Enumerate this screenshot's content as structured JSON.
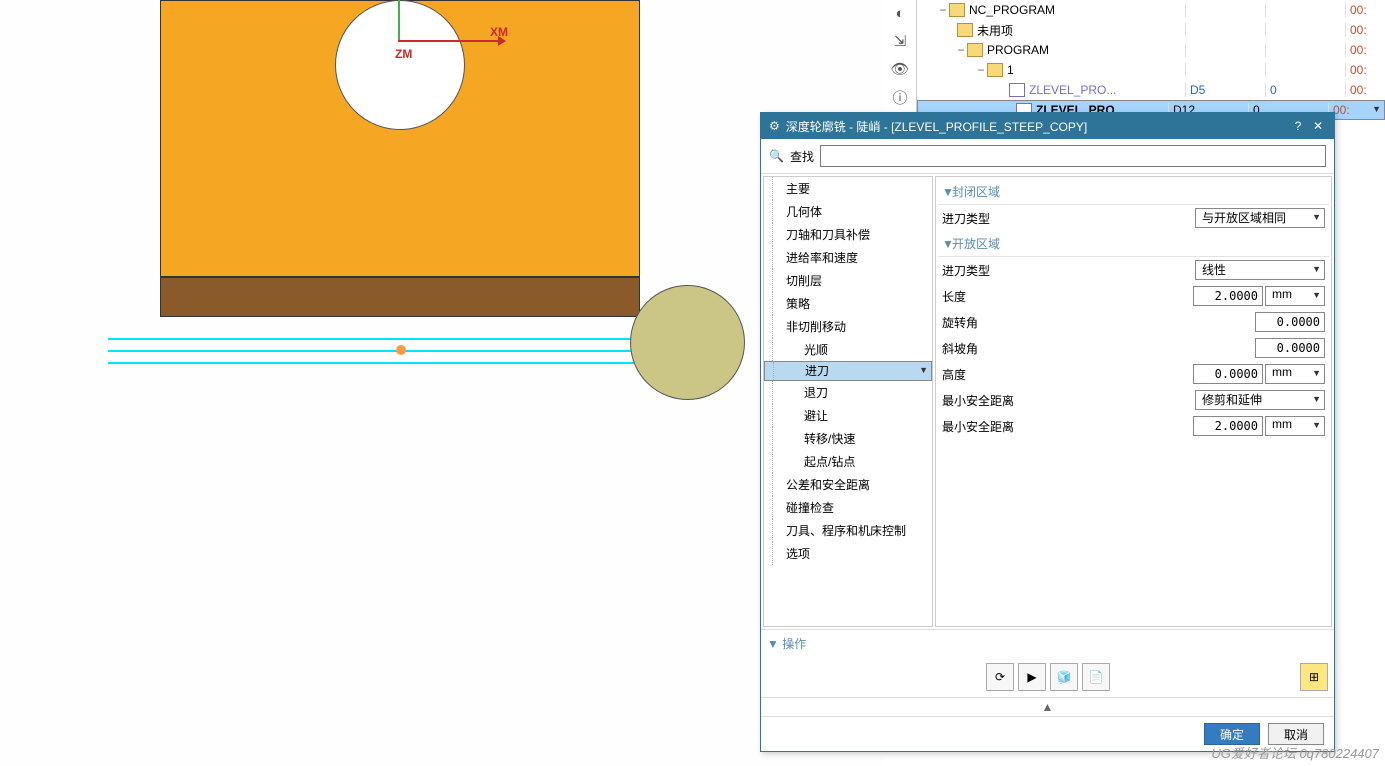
{
  "axis": {
    "xm": "XM",
    "zm": "ZM"
  },
  "iconbar": [
    "contrast-icon",
    "dimension-icon",
    "eye-icon",
    "info-icon"
  ],
  "tree": {
    "root": "NC_PROGRAM",
    "unused": "未用项",
    "program": "PROGRAM",
    "one": "1",
    "op1": {
      "name": "ZLEVEL_PRO...",
      "c1": "D5",
      "c2": "0",
      "time": "00:"
    },
    "op2": {
      "name": "ZLEVEL_PRO...",
      "c1": "D12",
      "c2": "0",
      "time": "00:"
    },
    "time0": "00:"
  },
  "dialog": {
    "title": "深度轮廓铣 - 陡峭 - [ZLEVEL_PROFILE_STEEP_COPY]",
    "help_icon": "?",
    "close_icon": "✕",
    "search_label": "查找",
    "nav": {
      "main": "主要",
      "geometry": "几何体",
      "tool_comp": "刀轴和刀具补偿",
      "feed_speed": "进给率和速度",
      "cut_layer": "切削层",
      "strategy": "策略",
      "noncut": "非切削移动",
      "smooth": "光顺",
      "engage": "进刀",
      "retract": "退刀",
      "avoid": "避让",
      "transfer": "转移/快速",
      "startpt": "起点/钻点",
      "tol_safe": "公差和安全距离",
      "collision": "碰撞检查",
      "machine": "刀具、程序和机床控制",
      "options": "选项"
    },
    "sections": {
      "closed": "封闭区域",
      "open": "开放区域"
    },
    "params": {
      "engage_type": "进刀类型",
      "same_as_open": "与开放区域相同",
      "engage_type_open": "进刀类型",
      "linear": "线性",
      "length": "长度",
      "length_v": "2.0000",
      "mm": "mm",
      "rotate": "旋转角",
      "rotate_v": "0.0000",
      "ramp": "斜坡角",
      "ramp_v": "0.0000",
      "height": "高度",
      "height_v": "0.0000",
      "minsafe": "最小安全距离",
      "trim_extend": "修剪和延伸",
      "minsafe2": "最小安全距离",
      "minsafe2_v": "2.0000"
    },
    "ops_label": "操作",
    "ok": "确定",
    "cancel": "取消"
  },
  "watermark": "UG爱好者论坛 0q780224407"
}
